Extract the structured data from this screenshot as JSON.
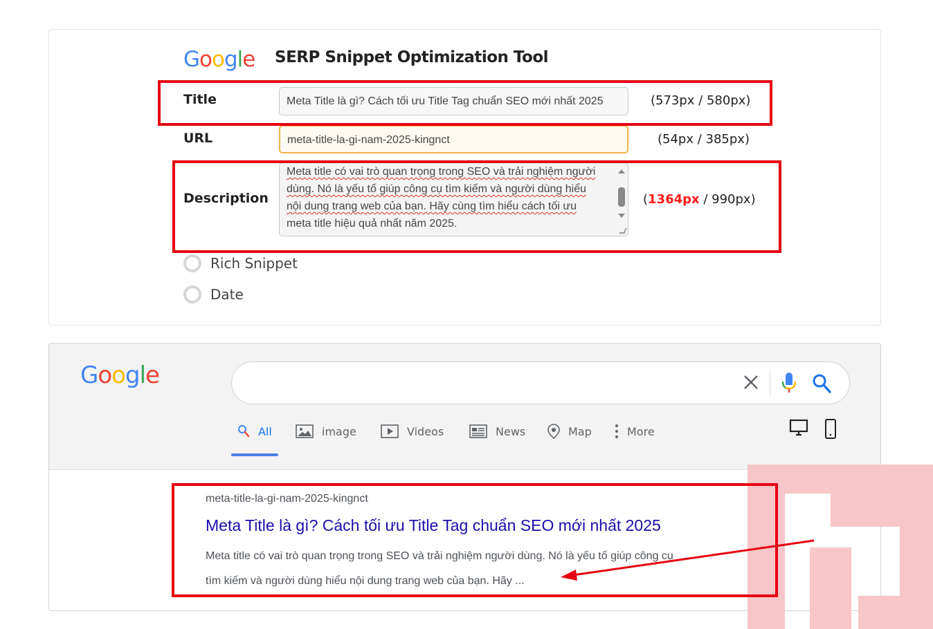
{
  "tool": {
    "logo_text": "Google",
    "logo_colors": [
      "#4285F4",
      "#EA4335",
      "#FBBC05",
      "#4285F4",
      "#34A853",
      "#EA4335"
    ],
    "title": "SERP Snippet Optimization Tool"
  },
  "form": {
    "title_label": "Title",
    "title_value": "Meta Title là gì? Cách tối ưu Title Tag chuẩn SEO mới nhất 2025",
    "title_count": "(573px / 580px)",
    "url_label": "URL",
    "url_value": "meta-title-la-gi-nam-2025-kingnct",
    "url_count": "(54px / 385px)",
    "desc_label": "Description",
    "desc_lines": [
      "Meta title có vai trò quan trọng trong SEO và trải nghiệm người",
      "dùng. Nó là yếu tố giúp công cụ tìm kiếm và người dùng hiểu",
      "nội dung trang web của bạn. Hãy cùng tìm hiểu cách tối ưu",
      "meta title hiệu quả nhất năm 2025."
    ],
    "desc_count_open": "(",
    "desc_count_value": "1364px",
    "desc_count_rest": " / 990px)",
    "over_color": "#ff1a1a",
    "options": [
      {
        "label": "Rich Snippet"
      },
      {
        "label": "Date"
      }
    ]
  },
  "serp": {
    "logo_text": "Google",
    "search_value": "",
    "tabs": [
      {
        "label": "All",
        "icon": "search-icon",
        "active": true
      },
      {
        "label": "image",
        "icon": "image-icon"
      },
      {
        "label": "Videos",
        "icon": "video-icon"
      },
      {
        "label": "News",
        "icon": "news-icon"
      },
      {
        "label": "Map",
        "icon": "map-pin-icon"
      },
      {
        "label": "More",
        "icon": "more-vertical-icon"
      }
    ],
    "devices": [
      "desktop-icon",
      "mobile-icon"
    ],
    "result": {
      "url": "meta-title-la-gi-nam-2025-kingnct",
      "title": "Meta Title là gì? Cách tối ưu Title Tag chuẩn SEO mới nhất 2025",
      "desc_line1": "Meta title có vai trò quan trọng trong SEO và trải nghiệm người dùng. Nó là yếu tố giúp công cụ",
      "desc_line2": "tìm kiếm và người dùng hiểu nội dung trang web của bạn. Hãy ..."
    }
  },
  "colors": {
    "highlight_box": "#e60012",
    "link": "#1a0dab",
    "active_tab": "#1a73e8"
  }
}
